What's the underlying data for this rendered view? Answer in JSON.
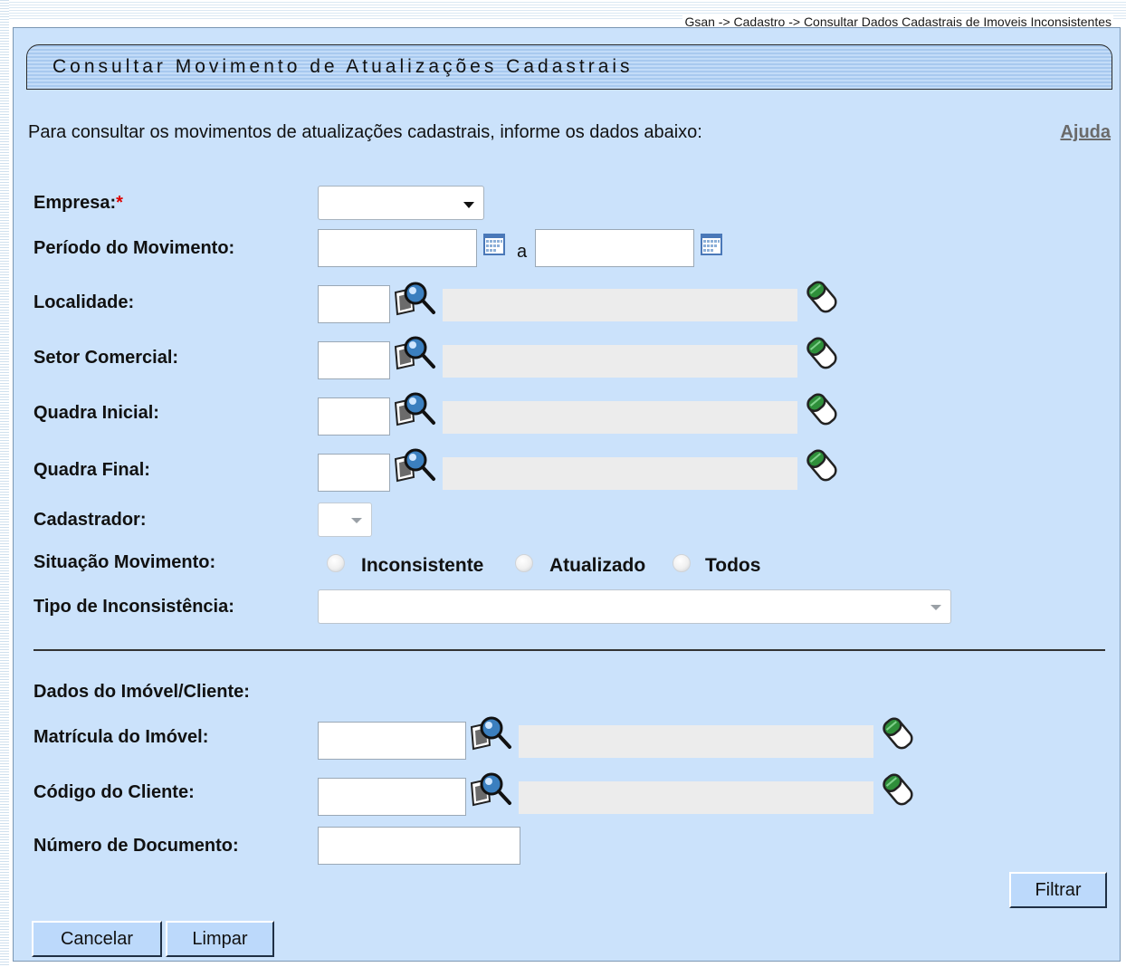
{
  "breadcrumb": "Gsan -> Cadastro -> Consultar Dados Cadastrais de Imoveis Inconsistentes",
  "title": "Consultar Movimento de Atualizações Cadastrais",
  "intro": "Para consultar os movimentos de atualizações cadastrais, informe os dados abaixo:",
  "help": "Ajuda",
  "labels": {
    "empresa": "Empresa:",
    "required_mark": "*",
    "periodo": "Período do Movimento:",
    "periodo_sep": "a",
    "localidade": "Localidade:",
    "setor": "Setor Comercial:",
    "quadra_inicial": "Quadra Inicial:",
    "quadra_final": "Quadra Final:",
    "cadastrador": "Cadastrador:",
    "situacao": "Situação Movimento:",
    "tipo": "Tipo de Inconsistência:",
    "dados": "Dados do Imóvel/Cliente:",
    "matricula": "Matrícula do Imóvel:",
    "cliente": "Código do Cliente:",
    "documento": "Número de Documento:"
  },
  "situacao_options": [
    "Inconsistente",
    "Atualizado",
    "Todos"
  ],
  "buttons": {
    "filtrar": "Filtrar",
    "cancelar": "Cancelar",
    "limpar": "Limpar"
  },
  "colors": {
    "panel_bg": "#cbe2fb",
    "button_bg": "#bcd9fb",
    "readonly_bg": "#ececec"
  }
}
